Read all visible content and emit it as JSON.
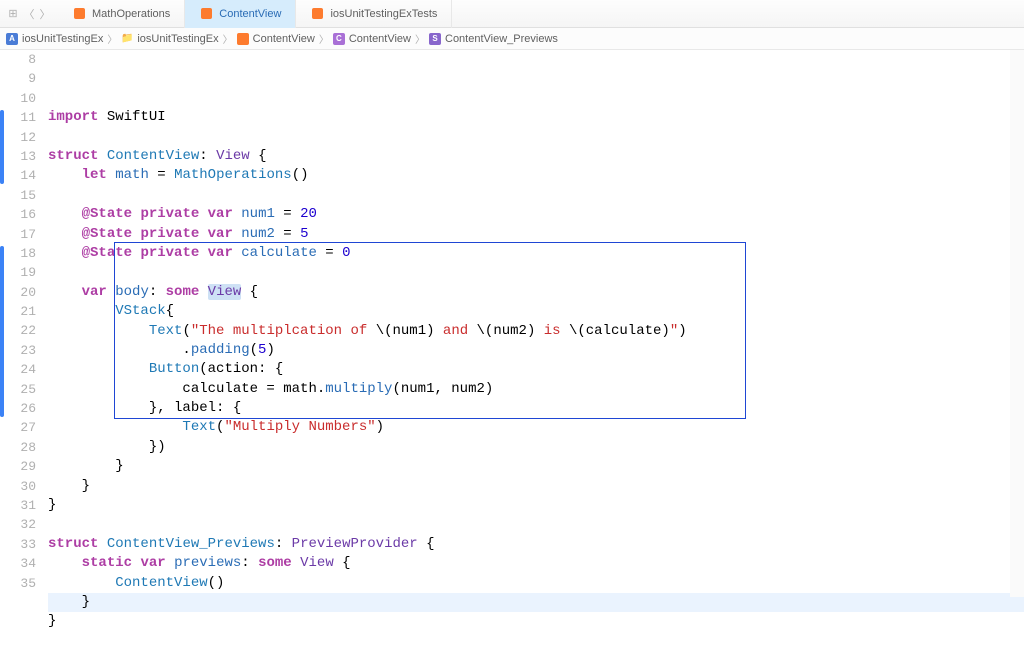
{
  "tabs": [
    {
      "label": "MathOperations"
    },
    {
      "label": "ContentView"
    },
    {
      "label": "iosUnitTestingExTests"
    }
  ],
  "activeTabIndex": 1,
  "breadcrumb": [
    {
      "icon": "app",
      "label": "iosUnitTestingEx"
    },
    {
      "icon": "folder",
      "label": "iosUnitTestingEx"
    },
    {
      "icon": "swift",
      "label": "ContentView"
    },
    {
      "icon": "c",
      "label": "ContentView"
    },
    {
      "icon": "s",
      "label": "ContentView_Previews"
    }
  ],
  "lineStart": 8,
  "lineEnd": 35,
  "currentLine": 33,
  "highlightedWord": "View",
  "changeMarkers": [
    {
      "from": 11,
      "to": 14
    },
    {
      "from": 18,
      "to": 26
    }
  ],
  "selectionBox": {
    "fromLine": 18,
    "toLine": 26
  },
  "code": {
    "l8": [
      [
        "kw",
        "import"
      ],
      [
        "plain",
        " SwiftUI"
      ]
    ],
    "l9": [],
    "l10": [
      [
        "kw",
        "struct"
      ],
      [
        "plain",
        " "
      ],
      [
        "type",
        "ContentView"
      ],
      [
        "plain",
        ": "
      ],
      [
        "type2",
        "View"
      ],
      [
        "plain",
        " {"
      ]
    ],
    "l11": [
      [
        "plain",
        "    "
      ],
      [
        "kw",
        "let"
      ],
      [
        "plain",
        " "
      ],
      [
        "ident",
        "math"
      ],
      [
        "plain",
        " = "
      ],
      [
        "type",
        "MathOperations"
      ],
      [
        "plain",
        "()"
      ]
    ],
    "l12": [],
    "l13": [
      [
        "plain",
        "    "
      ],
      [
        "kw",
        "@State"
      ],
      [
        "plain",
        " "
      ],
      [
        "kw",
        "private"
      ],
      [
        "plain",
        " "
      ],
      [
        "kw",
        "var"
      ],
      [
        "plain",
        " "
      ],
      [
        "ident",
        "num1"
      ],
      [
        "plain",
        " = "
      ],
      [
        "num",
        "20"
      ]
    ],
    "l14": [
      [
        "plain",
        "    "
      ],
      [
        "kw",
        "@State"
      ],
      [
        "plain",
        " "
      ],
      [
        "kw",
        "private"
      ],
      [
        "plain",
        " "
      ],
      [
        "kw",
        "var"
      ],
      [
        "plain",
        " "
      ],
      [
        "ident",
        "num2"
      ],
      [
        "plain",
        " = "
      ],
      [
        "num",
        "5"
      ]
    ],
    "l15": [
      [
        "plain",
        "    "
      ],
      [
        "kw",
        "@State"
      ],
      [
        "plain",
        " "
      ],
      [
        "kw",
        "private"
      ],
      [
        "plain",
        " "
      ],
      [
        "kw",
        "var"
      ],
      [
        "plain",
        " "
      ],
      [
        "ident",
        "calculate"
      ],
      [
        "plain",
        " = "
      ],
      [
        "num",
        "0"
      ]
    ],
    "l16": [],
    "l17": [
      [
        "plain",
        "    "
      ],
      [
        "kw",
        "var"
      ],
      [
        "plain",
        " "
      ],
      [
        "ident",
        "body"
      ],
      [
        "plain",
        ": "
      ],
      [
        "kw",
        "some"
      ],
      [
        "plain",
        " "
      ],
      [
        "hiword",
        "View"
      ],
      [
        "plain",
        " {"
      ]
    ],
    "l18": [
      [
        "plain",
        "        "
      ],
      [
        "type",
        "VStack"
      ],
      [
        "plain",
        "{"
      ]
    ],
    "l19": [
      [
        "plain",
        "            "
      ],
      [
        "type",
        "Text"
      ],
      [
        "plain",
        "("
      ],
      [
        "str",
        "\"The multiplcation of "
      ],
      [
        "plain",
        "\\("
      ],
      [
        "strint",
        "num1"
      ],
      [
        "plain",
        ")"
      ],
      [
        "str",
        " and "
      ],
      [
        "plain",
        "\\("
      ],
      [
        "strint",
        "num2"
      ],
      [
        "plain",
        ")"
      ],
      [
        "str",
        " is "
      ],
      [
        "plain",
        "\\("
      ],
      [
        "strint",
        "calculate"
      ],
      [
        "plain",
        ")"
      ],
      [
        "str",
        "\""
      ],
      [
        "plain",
        ")"
      ]
    ],
    "l20": [
      [
        "plain",
        "                ."
      ],
      [
        "func",
        "padding"
      ],
      [
        "plain",
        "("
      ],
      [
        "num",
        "5"
      ],
      [
        "plain",
        ")"
      ]
    ],
    "l21": [
      [
        "plain",
        "            "
      ],
      [
        "type",
        "Button"
      ],
      [
        "plain",
        "(action: {"
      ]
    ],
    "l22": [
      [
        "plain",
        "                calculate = math."
      ],
      [
        "func",
        "multiply"
      ],
      [
        "plain",
        "(num1, num2)"
      ]
    ],
    "l23": [
      [
        "plain",
        "            }, label: {"
      ]
    ],
    "l24": [
      [
        "plain",
        "                "
      ],
      [
        "type",
        "Text"
      ],
      [
        "plain",
        "("
      ],
      [
        "str",
        "\"Multiply Numbers\""
      ],
      [
        "plain",
        ")"
      ]
    ],
    "l25": [
      [
        "plain",
        "            })"
      ]
    ],
    "l26": [
      [
        "plain",
        "        }"
      ]
    ],
    "l27": [
      [
        "plain",
        "    }"
      ]
    ],
    "l28": [
      [
        "plain",
        "}"
      ]
    ],
    "l29": [],
    "l30": [
      [
        "kw",
        "struct"
      ],
      [
        "plain",
        " "
      ],
      [
        "type",
        "ContentView_Previews"
      ],
      [
        "plain",
        ": "
      ],
      [
        "type2",
        "PreviewProvider"
      ],
      [
        "plain",
        " {"
      ]
    ],
    "l31": [
      [
        "plain",
        "    "
      ],
      [
        "kw",
        "static"
      ],
      [
        "plain",
        " "
      ],
      [
        "kw",
        "var"
      ],
      [
        "plain",
        " "
      ],
      [
        "ident",
        "previews"
      ],
      [
        "plain",
        ": "
      ],
      [
        "kw",
        "some"
      ],
      [
        "plain",
        " "
      ],
      [
        "type2",
        "View"
      ],
      [
        "plain",
        " {"
      ]
    ],
    "l32": [
      [
        "plain",
        "        "
      ],
      [
        "type",
        "ContentView"
      ],
      [
        "plain",
        "()"
      ]
    ],
    "l33": [
      [
        "plain",
        "    }"
      ]
    ],
    "l34": [
      [
        "plain",
        "}"
      ]
    ],
    "l35": []
  }
}
